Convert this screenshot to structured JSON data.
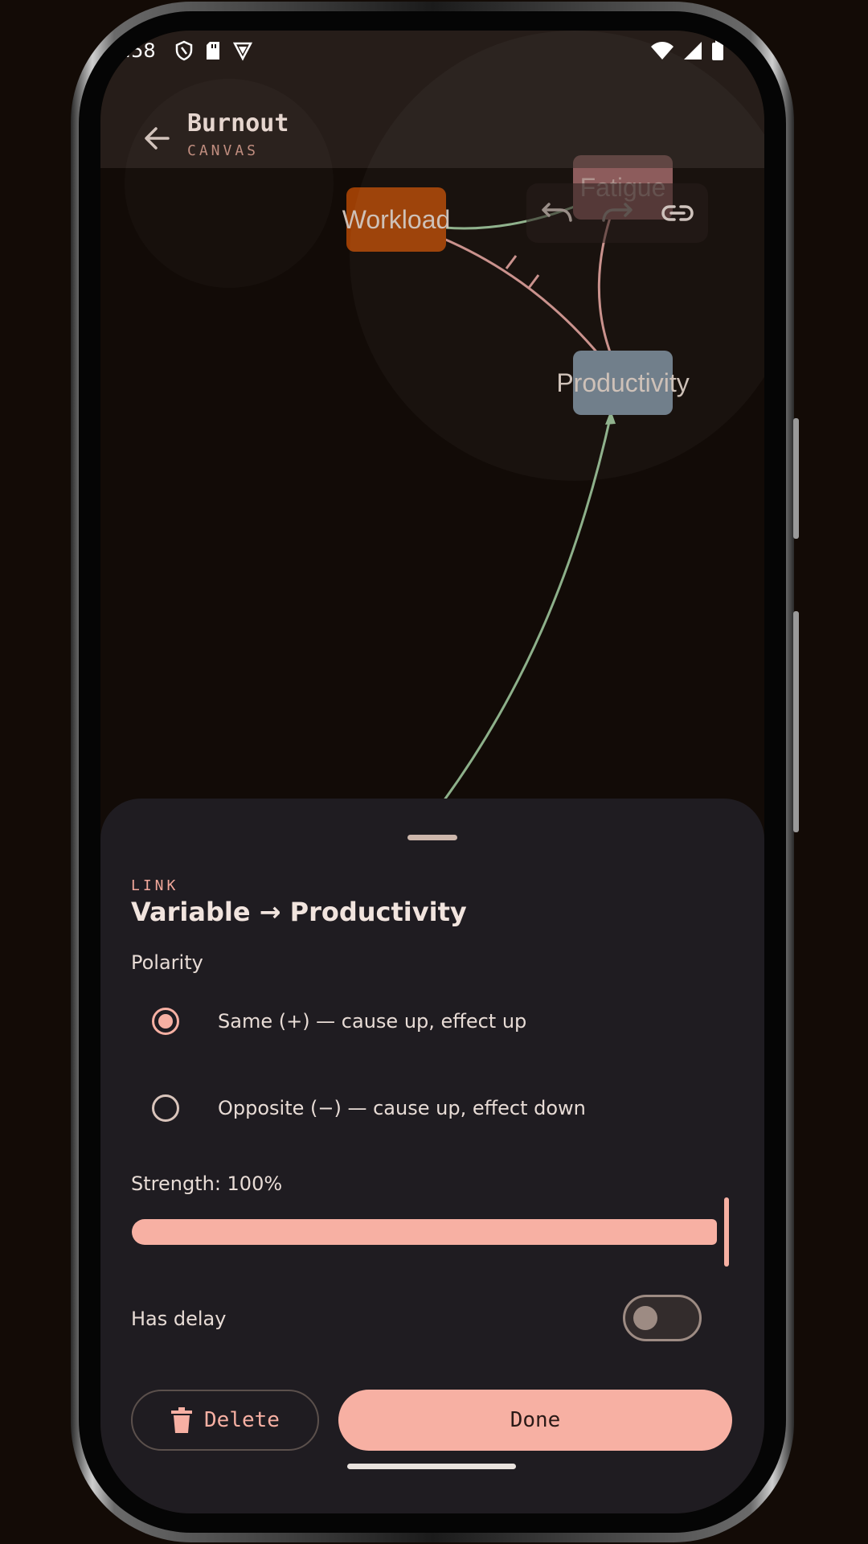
{
  "status_bar": {
    "time": ":58"
  },
  "app_bar": {
    "title": "Burnout",
    "subtitle": "CANVAS",
    "back_icon": "arrow-left-icon"
  },
  "toolbar": {
    "undo_icon": "undo-icon",
    "redo_icon": "redo-icon",
    "link_icon": "link-icon"
  },
  "canvas": {
    "nodes": [
      {
        "label": "Workload",
        "color": "#9b3e04"
      },
      {
        "label": "Productivity",
        "color": "#6d7b88"
      },
      {
        "label": "Fatigue",
        "color": "#8a5757"
      }
    ],
    "edge_colors": {
      "positive": "#8db08a",
      "negative": "#c98f8a"
    }
  },
  "sheet": {
    "overline": "LINK",
    "heading": "Variable → Productivity",
    "polarity_label": "Polarity",
    "polarity_options": [
      {
        "label": "Same (+) — cause up, effect up",
        "selected": true
      },
      {
        "label": "Opposite (−) — cause up, effect down",
        "selected": false
      }
    ],
    "strength_label": "Strength: 100%",
    "strength_value": 1.0,
    "delay_label": "Has delay",
    "delay_enabled": false,
    "delete_label": "Delete",
    "done_label": "Done"
  },
  "colors": {
    "accent": "#f7b0a3",
    "sheet_bg": "#1f1c21",
    "canvas_bg": "#120b07"
  }
}
